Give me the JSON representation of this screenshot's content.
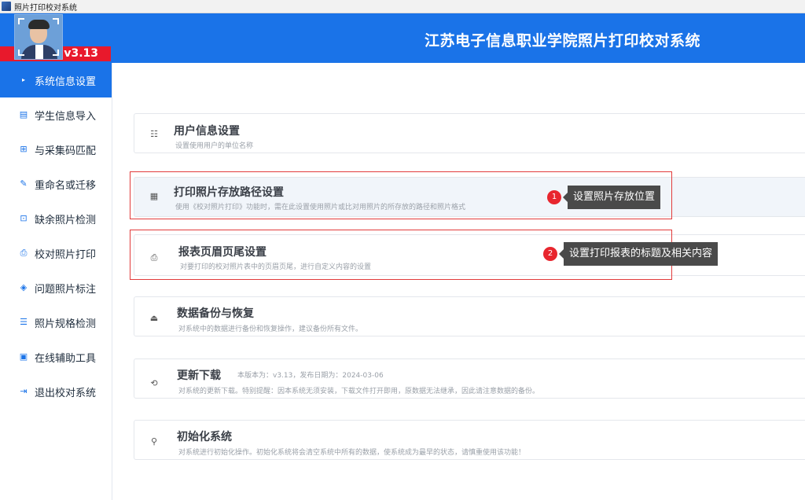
{
  "window": {
    "title": "照片打印校对系统"
  },
  "header": {
    "title": "江苏电子信息职业学院照片打印校对系统",
    "version": "v3.13"
  },
  "colors": {
    "primary": "#1a73e8",
    "version_badge": "#e8192c",
    "annotation_red": "#e23b3b",
    "tooltip_bg": "#4a4a4a"
  },
  "sidebar": {
    "items": [
      {
        "label": "系统信息设置",
        "icon": "bullet-icon",
        "active": true
      },
      {
        "label": "学生信息导入",
        "icon": "id-card-icon",
        "active": false
      },
      {
        "label": "与采集码匹配",
        "icon": "grid-match-icon",
        "active": false
      },
      {
        "label": "重命名或迁移",
        "icon": "image-edit-icon",
        "active": false
      },
      {
        "label": "缺余照片检测",
        "icon": "scan-icon",
        "active": false
      },
      {
        "label": "校对照片打印",
        "icon": "printer-icon",
        "active": false
      },
      {
        "label": "问题照片标注",
        "icon": "tag-icon",
        "active": false
      },
      {
        "label": "照片规格检测",
        "icon": "spec-list-icon",
        "active": false
      },
      {
        "label": "在线辅助工具",
        "icon": "monitor-icon",
        "active": false
      },
      {
        "label": "退出校对系统",
        "icon": "exit-icon",
        "active": false
      }
    ]
  },
  "settings": [
    {
      "title": "用户信息设置",
      "desc": "设置使用用户的单位名称",
      "icon": "user-list-icon"
    },
    {
      "title": "打印照片存放路径设置",
      "desc": "使用《校对照片打印》功能时，需在此设置使用照片或比对用照片的所存放的路径和照片格式",
      "icon": "folder-path-icon"
    },
    {
      "title": "报表页眉页尾设置",
      "desc": "对要打印的校对照片表中的页眉页尾，进行自定义内容的设置",
      "icon": "printer-icon"
    },
    {
      "title": "数据备份与恢复",
      "desc": "对系统中的数据进行备份和恢复操作，建议备份所有文件。",
      "icon": "backup-icon"
    },
    {
      "title": "更新下载",
      "desc": "对系统的更新下载。特别提醒：因本系统无须安装，下载文件打开即用，原数据无法继承，因此请注意数据的备份。",
      "icon": "download-icon",
      "meta": "本版本为：v3.13，发布日期为：2024-03-06"
    },
    {
      "title": "初始化系统",
      "desc": "对系统进行初始化操作。初始化系统将会清空系统中所有的数据，使系统成为最早的状态，请慎重使用该功能！",
      "icon": "reset-icon"
    }
  ],
  "annotations": [
    {
      "number": "1",
      "text": "设置照片存放位置"
    },
    {
      "number": "2",
      "text": "设置打印报表的标题及相关内容"
    }
  ]
}
